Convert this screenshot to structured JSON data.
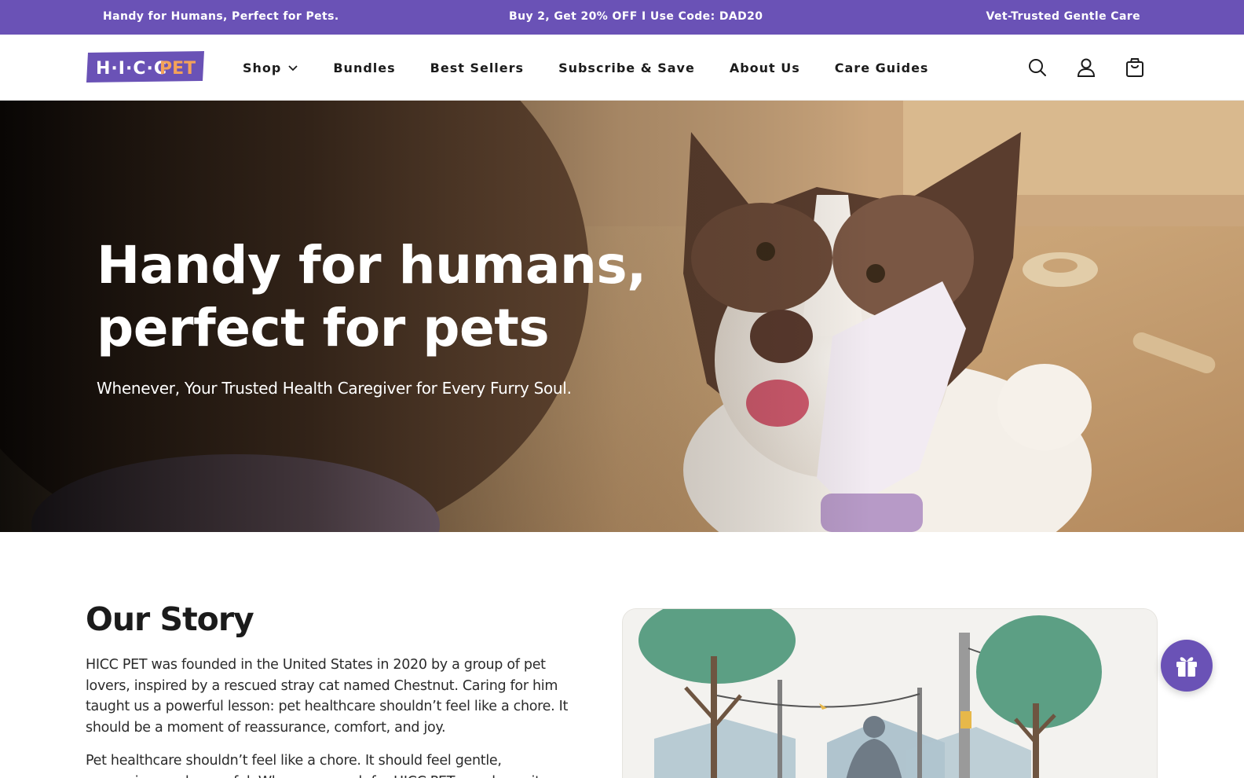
{
  "announcement": {
    "left": "Handy for Humans, Perfect for Pets.",
    "center": "Buy 2, Get 20% OFF I Use Code: DAD20",
    "right": "Vet-Trusted Gentle Care"
  },
  "header": {
    "logo_text": "H·I·C·C PET",
    "nav": [
      {
        "label": "Shop",
        "has_dropdown": true
      },
      {
        "label": "Bundles"
      },
      {
        "label": "Best Sellers"
      },
      {
        "label": "Subscribe & Save"
      },
      {
        "label": "About Us"
      },
      {
        "label": "Care Guides"
      }
    ],
    "icons": [
      "search-icon",
      "account-icon",
      "cart-icon"
    ]
  },
  "hero": {
    "title_line1": "Handy for humans,",
    "title_line2": "perfect for pets",
    "subtitle": "Whenever, Your Trusted Health Caregiver for Every Furry Soul."
  },
  "story": {
    "title": "Our Story",
    "paragraph1": "HICC PET was founded in the United States in 2020 by a group of pet lovers, inspired by a rescued stray cat named Chestnut. Caring for him taught us a powerful lesson: pet healthcare shouldn’t feel like a chore. It should be a moment of reassurance, comfort, and joy.",
    "paragraph2": "Pet healthcare shouldn’t feel like a chore. It should feel gentle, reassuring, and peaceful. When you reach for HICC PET, you know it was made with care."
  },
  "colors": {
    "brand_purple": "#6a52b6",
    "logo_orange": "#f4a259",
    "text_dark": "#1b1b1b"
  },
  "floating": {
    "gift_icon": "gift-icon"
  }
}
